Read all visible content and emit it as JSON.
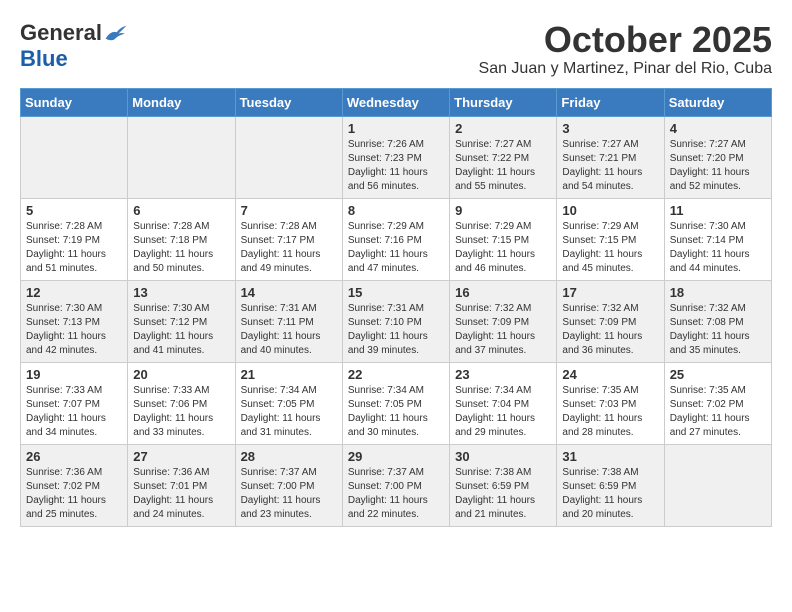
{
  "logo": {
    "general": "General",
    "blue": "Blue"
  },
  "title": {
    "month": "October 2025",
    "location": "San Juan y Martinez, Pinar del Rio, Cuba"
  },
  "weekdays": [
    "Sunday",
    "Monday",
    "Tuesday",
    "Wednesday",
    "Thursday",
    "Friday",
    "Saturday"
  ],
  "weeks": [
    [
      {
        "day": "",
        "info": ""
      },
      {
        "day": "",
        "info": ""
      },
      {
        "day": "",
        "info": ""
      },
      {
        "day": "1",
        "info": "Sunrise: 7:26 AM\nSunset: 7:23 PM\nDaylight: 11 hours\nand 56 minutes."
      },
      {
        "day": "2",
        "info": "Sunrise: 7:27 AM\nSunset: 7:22 PM\nDaylight: 11 hours\nand 55 minutes."
      },
      {
        "day": "3",
        "info": "Sunrise: 7:27 AM\nSunset: 7:21 PM\nDaylight: 11 hours\nand 54 minutes."
      },
      {
        "day": "4",
        "info": "Sunrise: 7:27 AM\nSunset: 7:20 PM\nDaylight: 11 hours\nand 52 minutes."
      }
    ],
    [
      {
        "day": "5",
        "info": "Sunrise: 7:28 AM\nSunset: 7:19 PM\nDaylight: 11 hours\nand 51 minutes."
      },
      {
        "day": "6",
        "info": "Sunrise: 7:28 AM\nSunset: 7:18 PM\nDaylight: 11 hours\nand 50 minutes."
      },
      {
        "day": "7",
        "info": "Sunrise: 7:28 AM\nSunset: 7:17 PM\nDaylight: 11 hours\nand 49 minutes."
      },
      {
        "day": "8",
        "info": "Sunrise: 7:29 AM\nSunset: 7:16 PM\nDaylight: 11 hours\nand 47 minutes."
      },
      {
        "day": "9",
        "info": "Sunrise: 7:29 AM\nSunset: 7:15 PM\nDaylight: 11 hours\nand 46 minutes."
      },
      {
        "day": "10",
        "info": "Sunrise: 7:29 AM\nSunset: 7:15 PM\nDaylight: 11 hours\nand 45 minutes."
      },
      {
        "day": "11",
        "info": "Sunrise: 7:30 AM\nSunset: 7:14 PM\nDaylight: 11 hours\nand 44 minutes."
      }
    ],
    [
      {
        "day": "12",
        "info": "Sunrise: 7:30 AM\nSunset: 7:13 PM\nDaylight: 11 hours\nand 42 minutes."
      },
      {
        "day": "13",
        "info": "Sunrise: 7:30 AM\nSunset: 7:12 PM\nDaylight: 11 hours\nand 41 minutes."
      },
      {
        "day": "14",
        "info": "Sunrise: 7:31 AM\nSunset: 7:11 PM\nDaylight: 11 hours\nand 40 minutes."
      },
      {
        "day": "15",
        "info": "Sunrise: 7:31 AM\nSunset: 7:10 PM\nDaylight: 11 hours\nand 39 minutes."
      },
      {
        "day": "16",
        "info": "Sunrise: 7:32 AM\nSunset: 7:09 PM\nDaylight: 11 hours\nand 37 minutes."
      },
      {
        "day": "17",
        "info": "Sunrise: 7:32 AM\nSunset: 7:09 PM\nDaylight: 11 hours\nand 36 minutes."
      },
      {
        "day": "18",
        "info": "Sunrise: 7:32 AM\nSunset: 7:08 PM\nDaylight: 11 hours\nand 35 minutes."
      }
    ],
    [
      {
        "day": "19",
        "info": "Sunrise: 7:33 AM\nSunset: 7:07 PM\nDaylight: 11 hours\nand 34 minutes."
      },
      {
        "day": "20",
        "info": "Sunrise: 7:33 AM\nSunset: 7:06 PM\nDaylight: 11 hours\nand 33 minutes."
      },
      {
        "day": "21",
        "info": "Sunrise: 7:34 AM\nSunset: 7:05 PM\nDaylight: 11 hours\nand 31 minutes."
      },
      {
        "day": "22",
        "info": "Sunrise: 7:34 AM\nSunset: 7:05 PM\nDaylight: 11 hours\nand 30 minutes."
      },
      {
        "day": "23",
        "info": "Sunrise: 7:34 AM\nSunset: 7:04 PM\nDaylight: 11 hours\nand 29 minutes."
      },
      {
        "day": "24",
        "info": "Sunrise: 7:35 AM\nSunset: 7:03 PM\nDaylight: 11 hours\nand 28 minutes."
      },
      {
        "day": "25",
        "info": "Sunrise: 7:35 AM\nSunset: 7:02 PM\nDaylight: 11 hours\nand 27 minutes."
      }
    ],
    [
      {
        "day": "26",
        "info": "Sunrise: 7:36 AM\nSunset: 7:02 PM\nDaylight: 11 hours\nand 25 minutes."
      },
      {
        "day": "27",
        "info": "Sunrise: 7:36 AM\nSunset: 7:01 PM\nDaylight: 11 hours\nand 24 minutes."
      },
      {
        "day": "28",
        "info": "Sunrise: 7:37 AM\nSunset: 7:00 PM\nDaylight: 11 hours\nand 23 minutes."
      },
      {
        "day": "29",
        "info": "Sunrise: 7:37 AM\nSunset: 7:00 PM\nDaylight: 11 hours\nand 22 minutes."
      },
      {
        "day": "30",
        "info": "Sunrise: 7:38 AM\nSunset: 6:59 PM\nDaylight: 11 hours\nand 21 minutes."
      },
      {
        "day": "31",
        "info": "Sunrise: 7:38 AM\nSunset: 6:59 PM\nDaylight: 11 hours\nand 20 minutes."
      },
      {
        "day": "",
        "info": ""
      }
    ]
  ]
}
